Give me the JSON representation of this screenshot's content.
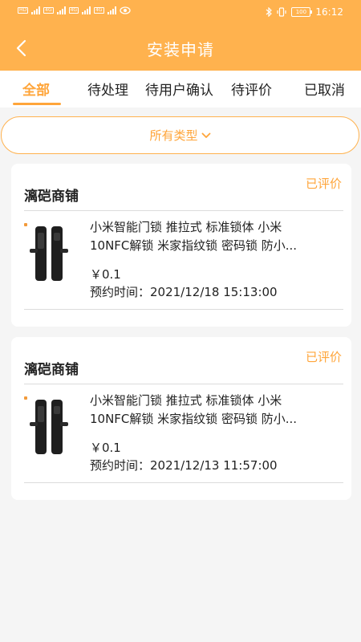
{
  "status_bar": {
    "net_tags": [
      "HD",
      "4G",
      "4G",
      "4G"
    ],
    "battery": "100",
    "time": "16:12"
  },
  "header": {
    "title": "安装申请"
  },
  "tabs": [
    {
      "label": "全部",
      "active": true
    },
    {
      "label": "待处理",
      "active": false
    },
    {
      "label": "待用户确认",
      "active": false
    },
    {
      "label": "待评价",
      "active": false
    },
    {
      "label": "已取消",
      "active": false
    }
  ],
  "filter": {
    "label": "所有类型"
  },
  "orders": [
    {
      "store": "漓硙商铺",
      "status": "已评价",
      "product_line1": "小米智能门锁 推拉式 标准锁体 小米",
      "product_line2": "10NFC解锁 米家指纹锁 密码锁 防小...",
      "price": "￥0.1",
      "time": "预约时间：2021/12/18 15:13:00"
    },
    {
      "store": "漓硙商铺",
      "status": "已评价",
      "product_line1": "小米智能门锁 推拉式 标准锁体 小米",
      "product_line2": "10NFC解锁 米家指纹锁 密码锁 防小...",
      "price": "￥0.1",
      "time": "预约时间：2021/12/13 11:57:00"
    }
  ],
  "colors": {
    "accent": "#ffb24e",
    "accent_text": "#ffa53a",
    "background": "#f5f5f5"
  }
}
